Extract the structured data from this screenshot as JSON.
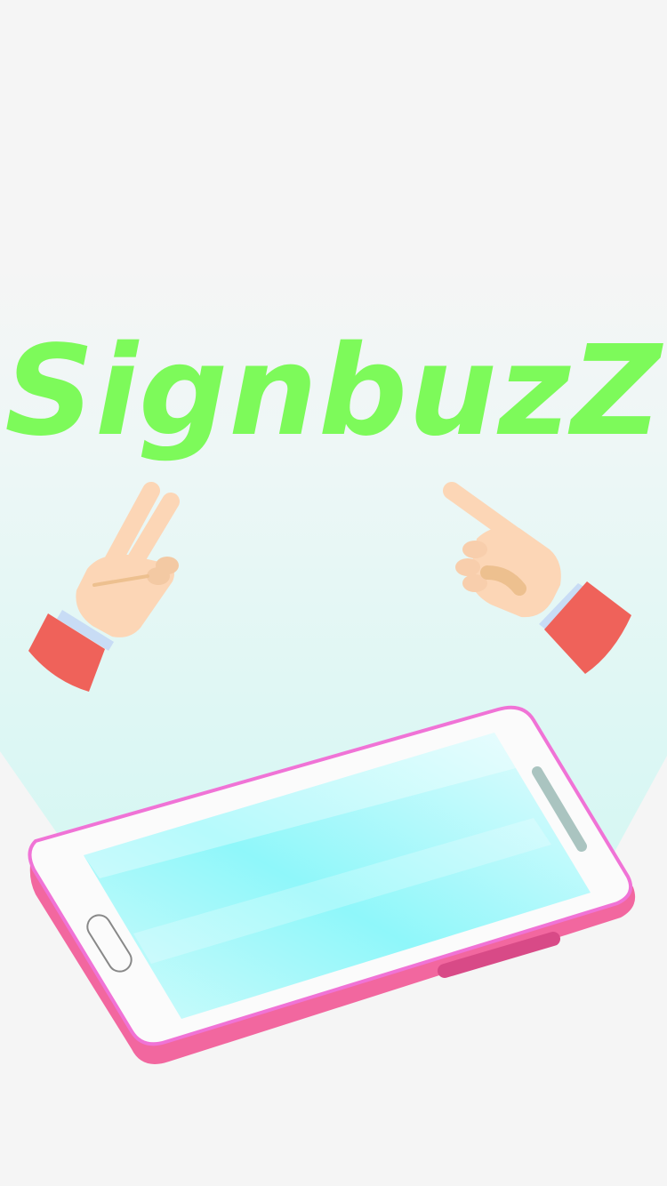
{
  "splash": {
    "title": "SignbuzZ"
  },
  "colors": {
    "background": "#f5f5f5",
    "title": "#7dfa5a",
    "sleeve": "#ef625a",
    "skin": "#fcd6b6",
    "skin_shadow": "#edc08f",
    "cuff": "#c8dcf5",
    "phone_body": "#f06ea0",
    "phone_edge": "#f073d6",
    "screen": "#8ffafa",
    "beam": "#dff7f4"
  },
  "icons": {
    "left_hand": "peace-sign-hand-icon",
    "right_hand": "pointing-hand-icon",
    "phone": "smartphone-illustration-icon"
  }
}
